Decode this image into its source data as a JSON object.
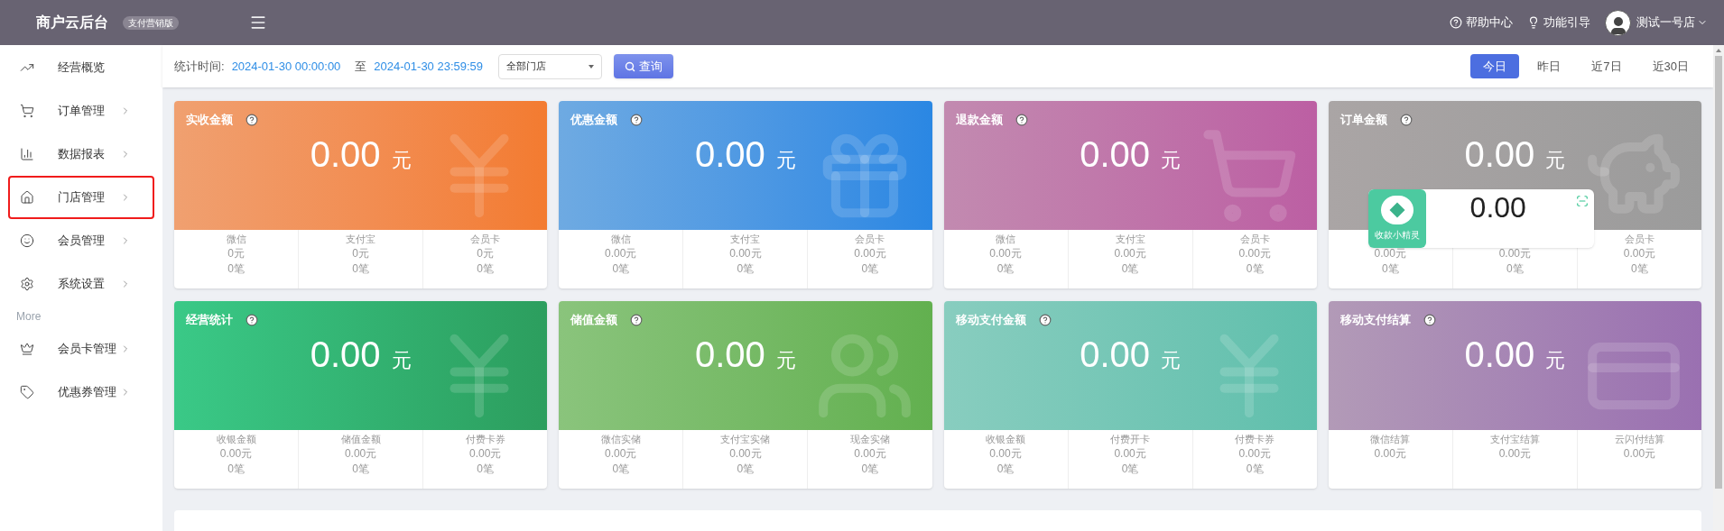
{
  "header": {
    "title": "商户云后台",
    "badge": "支付营销版",
    "links": [
      {
        "kind": "help",
        "label": "帮助中心"
      },
      {
        "kind": "guide",
        "label": "功能引导"
      }
    ],
    "user": "测试一号店"
  },
  "sidebar": {
    "items": [
      {
        "label": "经营概览",
        "has_children": false,
        "highlighted": false
      },
      {
        "label": "订单管理",
        "has_children": true,
        "highlighted": false
      },
      {
        "label": "数据报表",
        "has_children": true,
        "highlighted": false
      },
      {
        "label": "门店管理",
        "has_children": true,
        "highlighted": true
      },
      {
        "label": "会员管理",
        "has_children": true,
        "highlighted": false
      },
      {
        "label": "系统设置",
        "has_children": true,
        "highlighted": false
      }
    ],
    "section": "More",
    "more_items": [
      {
        "label": "会员卡管理",
        "has_children": true,
        "highlighted": false
      },
      {
        "label": "优惠券管理",
        "has_children": true,
        "highlighted": false
      }
    ]
  },
  "filter": {
    "label": "统计时间:",
    "start": "2024-01-30 00:00:00",
    "separator": "至",
    "end": "2024-01-30 23:59:59",
    "store_select": "全部门店",
    "query_button": "查询",
    "ranges": [
      {
        "label": "今日",
        "selected": true
      },
      {
        "label": "昨日",
        "selected": false
      },
      {
        "label": "近7日",
        "selected": false
      },
      {
        "label": "近30日",
        "selected": false
      }
    ]
  },
  "cards": [
    {
      "title": "实收金额",
      "amount": "0.00",
      "unit": "元",
      "cells": [
        {
          "label": "微信",
          "amount": "0元",
          "count": "0笔"
        },
        {
          "label": "支付宝",
          "amount": "0元",
          "count": "0笔"
        },
        {
          "label": "会员卡",
          "amount": "0元",
          "count": "0笔"
        }
      ]
    },
    {
      "title": "优惠金额",
      "amount": "0.00",
      "unit": "元",
      "cells": [
        {
          "label": "微信",
          "amount": "0.00元",
          "count": "0笔"
        },
        {
          "label": "支付宝",
          "amount": "0.00元",
          "count": "0笔"
        },
        {
          "label": "会员卡",
          "amount": "0.00元",
          "count": "0笔"
        }
      ]
    },
    {
      "title": "退款金额",
      "amount": "0.00",
      "unit": "元",
      "cells": [
        {
          "label": "微信",
          "amount": "0.00元",
          "count": "0笔"
        },
        {
          "label": "支付宝",
          "amount": "0.00元",
          "count": "0笔"
        },
        {
          "label": "会员卡",
          "amount": "0.00元",
          "count": "0笔"
        }
      ]
    },
    {
      "title": "订单金额",
      "amount": "0.00",
      "unit": "元",
      "cells": [
        {
          "amount": "0.00元",
          "count": "0笔"
        },
        {
          "amount": "0.00元",
          "count": "0笔"
        },
        {
          "label": "会员卡",
          "amount": "0.00元",
          "count": "0笔"
        }
      ]
    },
    {
      "title": "经营统计",
      "amount": "0.00",
      "unit": "元",
      "cells": [
        {
          "label": "收银金额",
          "amount": "0.00元",
          "count": "0笔"
        },
        {
          "label": "储值金额",
          "amount": "0.00元",
          "count": "0笔"
        },
        {
          "label": "付费卡券",
          "amount": "0.00元",
          "count": "0笔"
        }
      ]
    },
    {
      "title": "储值金额",
      "amount": "0.00",
      "unit": "元",
      "cells": [
        {
          "label": "微信实储",
          "amount": "0.00元",
          "count": "0笔"
        },
        {
          "label": "支付宝实储",
          "amount": "0.00元",
          "count": "0笔"
        },
        {
          "label": "现金实储",
          "amount": "0.00元",
          "count": "0笔"
        }
      ]
    },
    {
      "title": "移动支付金额",
      "amount": "0.00",
      "unit": "元",
      "cells": [
        {
          "label": "收银金额",
          "amount": "0.00元",
          "count": "0笔"
        },
        {
          "label": "付费开卡",
          "amount": "0.00元",
          "count": "0笔"
        },
        {
          "label": "付费卡券",
          "amount": "0.00元",
          "count": "0笔"
        }
      ]
    },
    {
      "title": "移动支付结算",
      "amount": "0.00",
      "unit": "元",
      "cells": [
        {
          "label": "微信结算",
          "amount": "0.00元"
        },
        {
          "label": "支付宝结算",
          "amount": "0.00元"
        },
        {
          "label": "云闪付结算",
          "amount": "0.00元"
        }
      ]
    }
  ],
  "widget": {
    "name": "收款小精灵",
    "amount": "0.00"
  }
}
